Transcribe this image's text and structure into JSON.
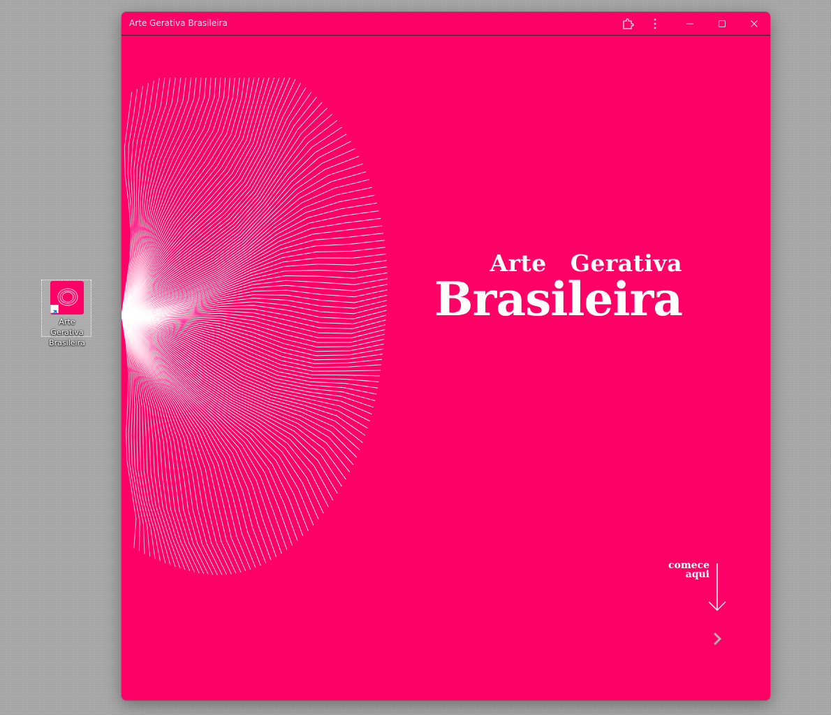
{
  "desktop": {
    "shortcut": {
      "label_line1": "Arte Gerativa",
      "label_line2": "Brasileira",
      "icon": "app-shortcut-icon"
    }
  },
  "window": {
    "title": "Arte Gerativa Brasileira",
    "controls": {
      "extensions": "extensions-icon",
      "menu": "more-vert-icon",
      "minimize": "minimize-icon",
      "maximize": "maximize-icon",
      "close": "close-icon"
    }
  },
  "page": {
    "background_color": "#ff0066",
    "headline": {
      "word1": "Arte",
      "word2": "Gerativa",
      "line2": "Brasileira"
    },
    "cta": {
      "line1": "comece",
      "line2": "aqui",
      "arrow_icon": "arrow-down-icon",
      "next_icon": "chevron-right-icon"
    }
  }
}
